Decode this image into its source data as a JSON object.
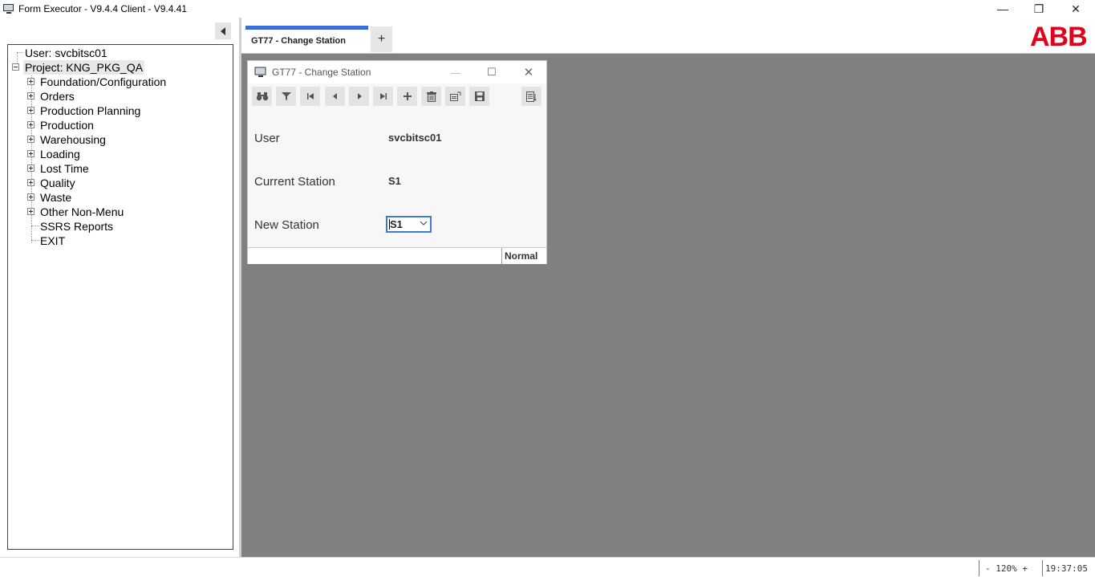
{
  "app": {
    "title": "Form Executor - V9.4.4   Client - V9.4.41",
    "window_controls": {
      "minimize": "—",
      "restore": "❐",
      "close": "✕"
    }
  },
  "tree": {
    "user_label": "User: svcbitsc01",
    "project_label": "Project: KNG_PKG_QA",
    "items": [
      {
        "label": "Foundation/Configuration",
        "expandable": true
      },
      {
        "label": "Orders",
        "expandable": true
      },
      {
        "label": "Production Planning",
        "expandable": true
      },
      {
        "label": "Production",
        "expandable": true
      },
      {
        "label": "Warehousing",
        "expandable": true
      },
      {
        "label": "Loading",
        "expandable": true
      },
      {
        "label": "Lost Time",
        "expandable": true
      },
      {
        "label": "Quality",
        "expandable": true
      },
      {
        "label": "Waste",
        "expandable": true
      },
      {
        "label": "Other Non-Menu",
        "expandable": true
      },
      {
        "label": "SSRS Reports",
        "expandable": false
      },
      {
        "label": "EXIT",
        "expandable": false
      }
    ]
  },
  "tabs": {
    "active_label": "GT77 - Change Station",
    "add_label": "+",
    "accent_color": "#3a6bd6"
  },
  "logo": {
    "text": "ABB",
    "color": "#e2001a"
  },
  "form": {
    "title": "GT77 - Change Station",
    "toolbar_icons": [
      "binoculars-icon",
      "filter-icon",
      "first-record-icon",
      "previous-record-icon",
      "next-record-icon",
      "last-record-icon",
      "add-record-icon",
      "delete-record-icon",
      "copy-record-icon",
      "save-icon",
      "report-icon"
    ],
    "fields": {
      "user_label": "User",
      "user_value": "svcbitsc01",
      "current_station_label": "Current Station",
      "current_station_value": "S1",
      "new_station_label": "New Station",
      "new_station_value": "S1"
    },
    "mode": "Normal"
  },
  "statusbar": {
    "zoom": "- 120% +",
    "clock": "19:37:05"
  }
}
